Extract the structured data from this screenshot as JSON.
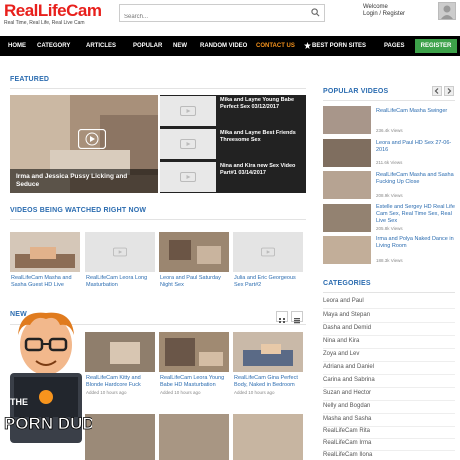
{
  "header": {
    "logo_main": "RealLifeCam",
    "logo_sub": "Real Time, Real Life, Real Live Cam",
    "search_placeholder": "Search...",
    "welcome": "Welcome",
    "login_register": "Login / Register"
  },
  "nav": {
    "items": [
      "HOME",
      "CATEGORY",
      "ARTICLES",
      "POPULAR",
      "NEW",
      "RANDOM VIDEO",
      "CONTACT US",
      "BEST PORN SITES",
      "PAGES"
    ],
    "register": "REGISTER"
  },
  "featured": {
    "title": "FEATURED",
    "main_caption": "Irma and Jessica Pussy Licking and Seduce",
    "side": [
      "Mika and Layne Young Babe Perfect Sex 03/12/2017",
      "Mika and Layne Best Friends Threesome Sex",
      "Nina and Kira new Sex Video Part#1 03/14/2017"
    ]
  },
  "watching": {
    "title": "VIDEOS BEING WATCHED RIGHT NOW",
    "items": [
      "RealLifeCam Masha and Sasha Guest HD Live",
      "RealLifeCam Leora Long Masturbation",
      "Leora and Paul Saturday Night Sex",
      "Julia and Eric Georgeous Sex Part#2"
    ]
  },
  "new_section": {
    "title": "NEW",
    "items": [
      {
        "title": "RealLifeCam Kitty and Blonde Hardcore Fuck",
        "meta": "Added 10 hours ago"
      },
      {
        "title": "RealLifeCam Leora Young Babe HD Masturbation",
        "meta": "Added 10 hours ago"
      },
      {
        "title": "RealLifeCam Gina Perfect Body, Naked in Bedroom",
        "meta": "Added 10 hours ago"
      }
    ]
  },
  "popular": {
    "title": "POPULAR VIDEOS",
    "items": [
      {
        "title": "RealLifeCam Masha Swinger",
        "views": "236.4k Views"
      },
      {
        "title": "Leora and Paul HD Sex 27-06-2016",
        "views": "211.6k Views"
      },
      {
        "title": "RealLifeCam Masha and Sasha Fucking Up Close",
        "views": "208.9k Views"
      },
      {
        "title": "Estelle and Sergey HD Real Life Cam Sex, Real Time Sex, Real Live Sex",
        "views": "205.8k Views"
      },
      {
        "title": "Irma and Polya Naked Dance in Living Room",
        "views": "188.3k Views"
      }
    ]
  },
  "categories": {
    "title": "CATEGORIES",
    "items": [
      "Leora and Paul",
      "Maya and Stepan",
      "Dasha and Demid",
      "Nina and Kira",
      "Zoya and Lev",
      "Adriana and Daniel",
      "Carina and Sabrina",
      "Suzan and Hector",
      "Nelly and Bogdan",
      "Masha and Sasha",
      "RealLifeCam Rita",
      "RealLifeCam Irma",
      "RealLifeCam Ilona"
    ]
  },
  "badge": {
    "text_top": "THE",
    "text_main": "PORN DUDE"
  },
  "colors": {
    "brand_red": "#e8201c",
    "link_blue": "#2b6cb0",
    "nav_bg": "#000000",
    "accent_orange": "#f7941d",
    "register_green": "#3da24a"
  }
}
